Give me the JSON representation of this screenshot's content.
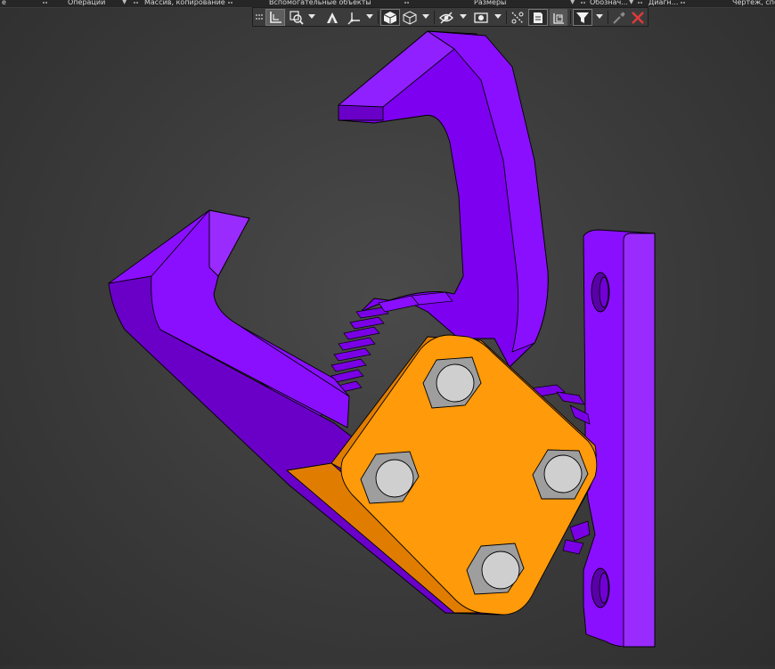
{
  "app": {
    "panel_tabs": [
      {
        "label": "е"
      },
      {
        "label": "Операции"
      },
      {
        "label": "Массив, копирование"
      },
      {
        "label": "Вспомогательные объекты"
      },
      {
        "label": "Размеры"
      },
      {
        "label": "Обознач..."
      },
      {
        "label": "Диагн..."
      },
      {
        "label": "Чертеж, спец"
      }
    ]
  },
  "toolbar": {
    "icons": [
      "grip-icon",
      "coordinate-system-icon",
      "zoom-icon",
      "orientation-icon",
      "axes-icon",
      "shaded-cube-icon",
      "wireframe-cube-icon",
      "visibility-icon",
      "display-mode-icon",
      "section-icon",
      "render-icon",
      "layers-icon",
      "filter-icon",
      "eyedropper-icon",
      "close-x-icon"
    ],
    "close_color": "#e03a3a"
  },
  "model": {
    "colors": {
      "purple_face": "#8a0fff",
      "purple_dark": "#6a00c8",
      "purple_side": "#7d00f0",
      "orange_face": "#ff9a0a",
      "orange_side": "#e07d00",
      "bolt_face": "#cfcfcf",
      "bolt_side": "#9e9e9e"
    }
  }
}
